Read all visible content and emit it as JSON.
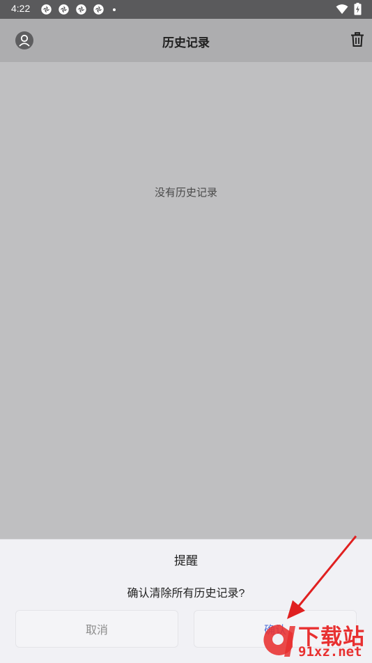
{
  "status_bar": {
    "time": "4:22",
    "notification_icons": [
      "app-notification-icon",
      "app-notification-icon",
      "app-notification-icon",
      "app-notification-icon"
    ],
    "more_dot": "•"
  },
  "app_bar": {
    "title": "历史记录",
    "left_icon": "account-icon",
    "right_icon": "trash-icon"
  },
  "main": {
    "empty_text": "没有历史记录"
  },
  "dialog": {
    "title": "提醒",
    "message": "确认清除所有历史记录?",
    "cancel_label": "取消",
    "confirm_label": "确认"
  },
  "watermark": {
    "brand_text": "下载站",
    "url_text": "91xz.net"
  },
  "colors": {
    "accent": "#5a78d8",
    "annotation_red": "#e02020",
    "watermark_red": "#e83030"
  }
}
